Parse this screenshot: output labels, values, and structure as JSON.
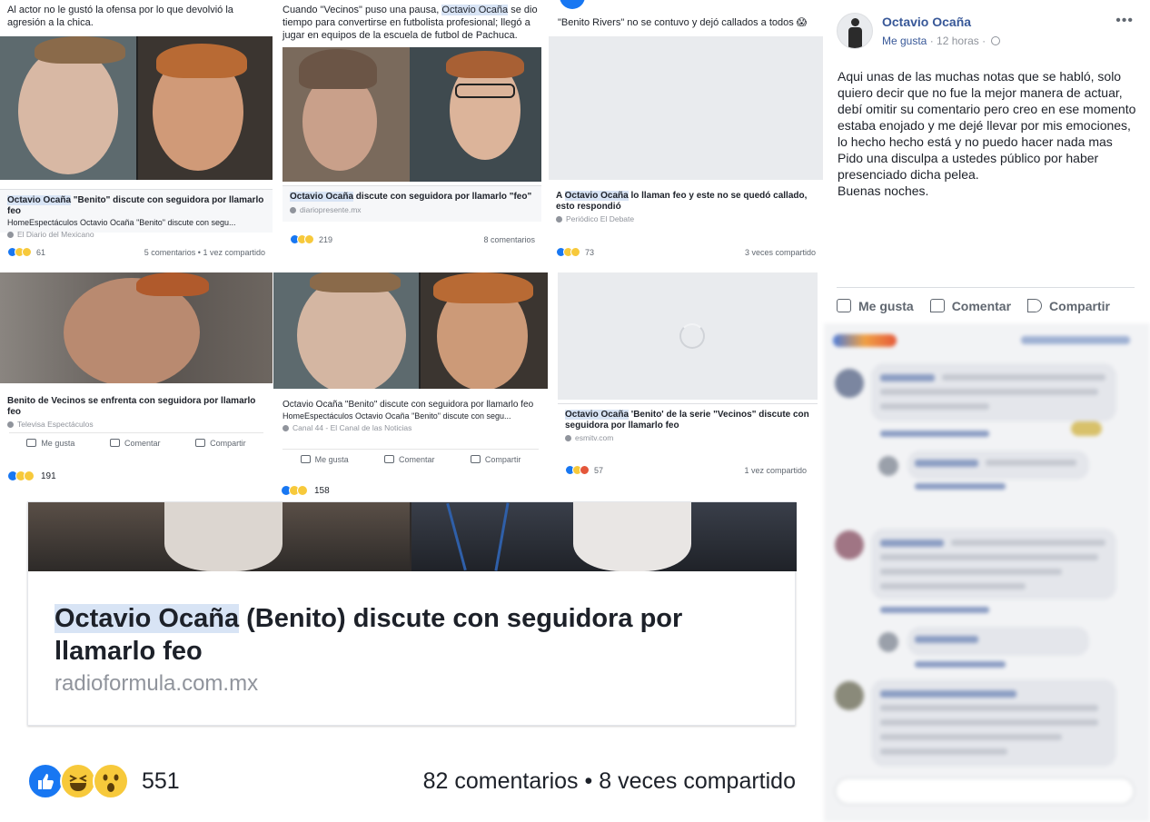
{
  "collage": {
    "card1": {
      "text": "Al actor no le gustó la ofensa por lo que devolvió la agresión a la chica.",
      "link_title_hl": "Octavio Ocaña",
      "link_title_rest": " \"Benito\" discute con seguidora por llamarlo feo",
      "link_desc": "HomeEspectáculos Octavio Ocaña \"Benito\" discute con segu...",
      "link_source": "El Diario del Mexicano",
      "reactions": "61",
      "right_stats": "5 comentarios • 1 vez compartido"
    },
    "card2": {
      "text_a": "Cuando \"Vecinos\" puso una pausa, ",
      "text_hl": "Octavio Ocaña",
      "text_b": " se dio tiempo para convertirse en futbolista profesional; llegó a jugar en equipos de la escuela de futbol de Pachuca.",
      "link_title_hl": "Octavio Ocaña",
      "link_title_rest": " discute con seguidora por llamarlo \"feo\"",
      "link_domain": "diariopresente.mx",
      "reactions": "219",
      "right_stats": "8 comentarios"
    },
    "card3": {
      "text": "\"Benito Rivers\" no se contuvo y dejó callados a todos 😱",
      "link_title_a": "A ",
      "link_title_hl": "Octavio Ocaña",
      "link_title_rest": " lo llaman feo y este no se quedó callado, esto respondió",
      "link_source": "Periódico El Debate",
      "reactions": "73",
      "right_stats": "3 veces compartido"
    },
    "card4": {
      "link_title": "Benito de Vecinos se enfrenta con seguidora por llamarlo feo",
      "link_source": "Televisa Espectáculos",
      "action_like": "Me gusta",
      "action_comment": "Comentar",
      "action_share": "Compartir",
      "reactions": "191"
    },
    "card5": {
      "link_title": "Octavio Ocaña \"Benito\" discute con seguidora por llamarlo feo",
      "link_desc": "HomeEspectáculos Octavio Ocaña \"Benito\" discute con segu...",
      "link_source": "Canal 44 - El Canal de las Noticias",
      "action_like": "Me gusta",
      "action_comment": "Comentar",
      "action_share": "Compartir",
      "reactions": "158"
    },
    "card6": {
      "link_title_hl": "Octavio Ocaña",
      "link_title_rest": " 'Benito' de la serie \"Vecinos\" discute con seguidora por llamarlo feo",
      "link_domain": "esmitv.com",
      "reactions": "57",
      "right_stats": "1 vez compartido"
    }
  },
  "big_link": {
    "title_hl": "Octavio Ocaña",
    "title_rest": " (Benito) discute con seguidora por llamarlo feo",
    "domain": "radioformula.com.mx",
    "reactions_count": "551",
    "comments": "82 comentarios",
    "separator": "•",
    "shares": "8 veces compartido"
  },
  "post": {
    "author": "Octavio Ocaña",
    "like_link": "Me gusta",
    "time": "12 horas",
    "more": "•••",
    "body_lines": [
      "Aqui unas de las muchas notas que se habló, solo quiero decir que no fue la mejor manera de actuar, debí omitir su comentario pero creo en ese momento estaba enojado y me dejé llevar por mis emociones, lo hecho hecho está y no puedo hacer nada mas",
      "Pido una disculpa a ustedes público por haber presenciado dicha pelea.",
      "Buenas noches."
    ],
    "actions": {
      "like": "Me gusta",
      "comment": "Comentar",
      "share": "Compartir"
    }
  },
  "colors": {
    "facebook_blue": "#385898",
    "like_blue": "#1877f2",
    "highlight": "#d8e4f5",
    "meta_gray": "#90949c"
  }
}
